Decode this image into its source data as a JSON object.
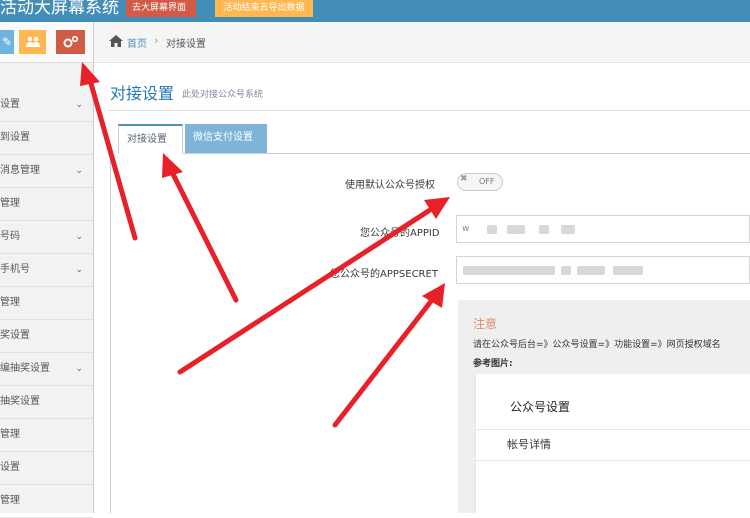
{
  "topbar": {
    "app_title": "活动大屏幕系统",
    "btn_screen": "去大屏幕界面",
    "btn_export": "活动结束去导出数据"
  },
  "shortcuts": [
    {
      "name": "shortcut-edit",
      "glyph": "✎"
    },
    {
      "name": "shortcut-users",
      "glyph": "👥"
    },
    {
      "name": "shortcut-settings",
      "glyph": "⚙"
    }
  ],
  "sidebar": {
    "items": [
      {
        "label": "设置",
        "chevron": true
      },
      {
        "label": "到设置",
        "chevron": false
      },
      {
        "label": "消息管理",
        "chevron": true
      },
      {
        "label": "管理",
        "chevron": false
      },
      {
        "label": "号码",
        "chevron": true
      },
      {
        "label": "手机号",
        "chevron": true
      },
      {
        "label": "管理",
        "chevron": false
      },
      {
        "label": "奖设置",
        "chevron": false
      },
      {
        "label": "编抽奖设置",
        "chevron": true
      },
      {
        "label": "抽奖设置",
        "chevron": false
      },
      {
        "label": "管理",
        "chevron": false
      },
      {
        "label": "设置",
        "chevron": false
      },
      {
        "label": "管理",
        "chevron": false
      }
    ]
  },
  "breadcrumb": {
    "home": "首页",
    "separator": "›",
    "current": "对接设置"
  },
  "page": {
    "title": "对接设置",
    "subtitle": "此处对接公众号系统"
  },
  "tabs": [
    {
      "label": "对接设置",
      "active": true
    },
    {
      "label": "微信支付设置",
      "active": false
    }
  ],
  "form": {
    "default_auth_label": "使用默认公众号授权",
    "toggle_state": "OFF",
    "appid_label": "您公众号的APPID",
    "appid_value": "w",
    "secret_label": "您公众号的APPSECRET",
    "secret_value": ""
  },
  "notice": {
    "title": "注意",
    "text": "请在公众号后台=》公众号设置=》功能设置=》网页授权域名",
    "ref_label": "参考图片:",
    "ref_heading": "公众号设置",
    "ref_detail": "帐号详情"
  },
  "colors": {
    "topbar": "#438eb9",
    "screen_button": "#d15b47",
    "export_button": "#ffb752",
    "link": "#4c8fbd",
    "arrow": "#e8202a"
  }
}
